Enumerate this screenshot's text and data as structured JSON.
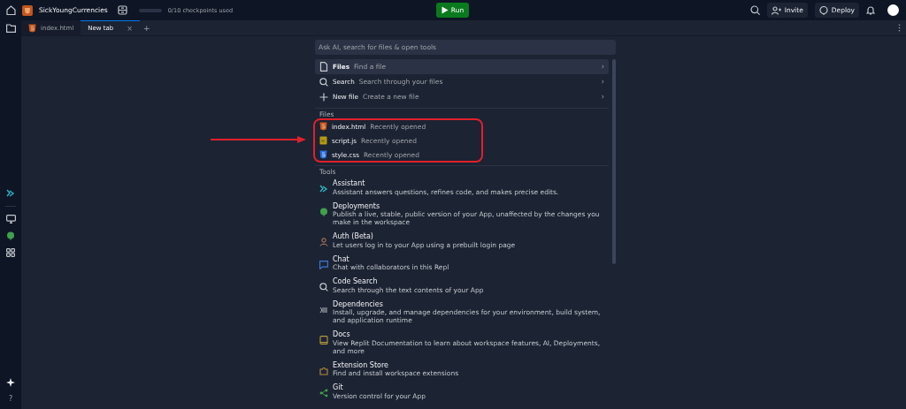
{
  "topbar": {
    "project": "SickYoungCurrencies",
    "checkpoints": "0/10 checkpoints used",
    "run": "Run",
    "invite": "Invite",
    "deploy": "Deploy"
  },
  "tabs": [
    {
      "label": "index.html",
      "selected": false,
      "kind": "html"
    },
    {
      "label": "New tab",
      "selected": true,
      "kind": "plain",
      "close": "×"
    }
  ],
  "new_tab": "+",
  "rail": {
    "help": "?"
  },
  "palette": {
    "placeholder": "Ask AI, search for files & open tools",
    "actions": [
      {
        "kind": "file",
        "title": "Files",
        "hint": "Find a file",
        "selected": true,
        "chevron": "›"
      },
      {
        "kind": "search",
        "title": "Search",
        "hint": "Search through your files",
        "selected": false,
        "chevron": "›"
      },
      {
        "kind": "plus",
        "title": "New file",
        "hint": "Create a new file",
        "selected": false,
        "chevron": "›"
      }
    ],
    "files_heading": "Files",
    "files": [
      {
        "kind": "html",
        "name": "index.html",
        "hint": "Recently opened"
      },
      {
        "kind": "js",
        "name": "script.js",
        "hint": "Recently opened"
      },
      {
        "kind": "css",
        "name": "style.css",
        "hint": "Recently opened"
      }
    ],
    "tools_heading": "Tools",
    "tools": [
      {
        "kind": "assistant",
        "title": "Assistant",
        "description": "Assistant answers questions, refines code, and makes precise edits."
      },
      {
        "kind": "deploy",
        "title": "Deployments",
        "description": "Publish a live, stable, public version of your App, unaffected by the changes you make in the workspace"
      },
      {
        "kind": "auth",
        "title": "Auth (Beta)",
        "description": "Let users log in to your App using a prebuilt login page"
      },
      {
        "kind": "chat",
        "title": "Chat",
        "description": "Chat with collaborators in this Repl"
      },
      {
        "kind": "search",
        "title": "Code Search",
        "description": "Search through the text contents of your App"
      },
      {
        "kind": "deps",
        "title": "Dependencies",
        "description": "Install, upgrade, and manage dependencies for your environment, build system, and application runtime"
      },
      {
        "kind": "docs",
        "title": "Docs",
        "description": "View Replit Documentation to learn about workspace features, AI, Deployments, and more"
      },
      {
        "kind": "extension",
        "title": "Extension Store",
        "description": "Find and install workspace extensions"
      },
      {
        "kind": "git",
        "title": "Git",
        "description": "Version control for your App"
      }
    ]
  }
}
